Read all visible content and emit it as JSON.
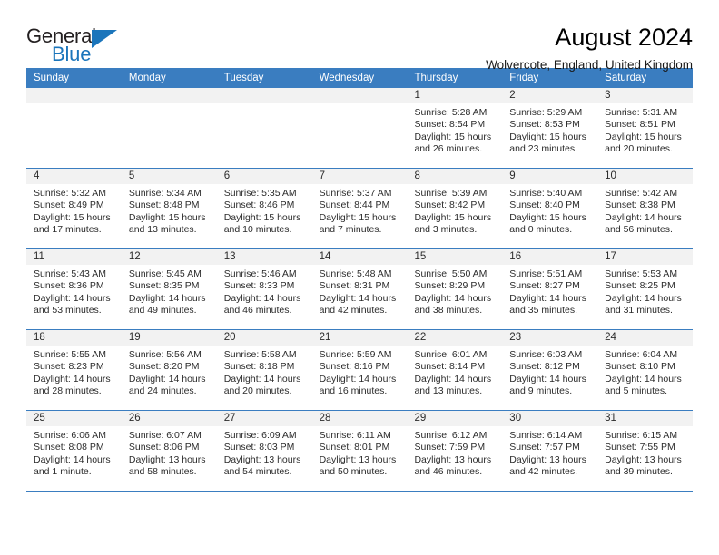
{
  "logo": {
    "word_top": "General",
    "word_bottom": "Blue",
    "accent_color": "#1b75bb"
  },
  "header": {
    "title": "August 2024",
    "location": "Wolvercote, England, United Kingdom",
    "header_bg_color": "#3a7dc0"
  },
  "calendar": {
    "day_headers": [
      "Sunday",
      "Monday",
      "Tuesday",
      "Wednesday",
      "Thursday",
      "Friday",
      "Saturday"
    ],
    "weeks": [
      [
        {
          "day": "",
          "empty": true
        },
        {
          "day": "",
          "empty": true
        },
        {
          "day": "",
          "empty": true
        },
        {
          "day": "",
          "empty": true
        },
        {
          "day": "1",
          "sunrise": "Sunrise: 5:28 AM",
          "sunset": "Sunset: 8:54 PM",
          "daylight1": "Daylight: 15 hours",
          "daylight2": "and 26 minutes."
        },
        {
          "day": "2",
          "sunrise": "Sunrise: 5:29 AM",
          "sunset": "Sunset: 8:53 PM",
          "daylight1": "Daylight: 15 hours",
          "daylight2": "and 23 minutes."
        },
        {
          "day": "3",
          "sunrise": "Sunrise: 5:31 AM",
          "sunset": "Sunset: 8:51 PM",
          "daylight1": "Daylight: 15 hours",
          "daylight2": "and 20 minutes."
        }
      ],
      [
        {
          "day": "4",
          "sunrise": "Sunrise: 5:32 AM",
          "sunset": "Sunset: 8:49 PM",
          "daylight1": "Daylight: 15 hours",
          "daylight2": "and 17 minutes."
        },
        {
          "day": "5",
          "sunrise": "Sunrise: 5:34 AM",
          "sunset": "Sunset: 8:48 PM",
          "daylight1": "Daylight: 15 hours",
          "daylight2": "and 13 minutes."
        },
        {
          "day": "6",
          "sunrise": "Sunrise: 5:35 AM",
          "sunset": "Sunset: 8:46 PM",
          "daylight1": "Daylight: 15 hours",
          "daylight2": "and 10 minutes."
        },
        {
          "day": "7",
          "sunrise": "Sunrise: 5:37 AM",
          "sunset": "Sunset: 8:44 PM",
          "daylight1": "Daylight: 15 hours",
          "daylight2": "and 7 minutes."
        },
        {
          "day": "8",
          "sunrise": "Sunrise: 5:39 AM",
          "sunset": "Sunset: 8:42 PM",
          "daylight1": "Daylight: 15 hours",
          "daylight2": "and 3 minutes."
        },
        {
          "day": "9",
          "sunrise": "Sunrise: 5:40 AM",
          "sunset": "Sunset: 8:40 PM",
          "daylight1": "Daylight: 15 hours",
          "daylight2": "and 0 minutes."
        },
        {
          "day": "10",
          "sunrise": "Sunrise: 5:42 AM",
          "sunset": "Sunset: 8:38 PM",
          "daylight1": "Daylight: 14 hours",
          "daylight2": "and 56 minutes."
        }
      ],
      [
        {
          "day": "11",
          "sunrise": "Sunrise: 5:43 AM",
          "sunset": "Sunset: 8:36 PM",
          "daylight1": "Daylight: 14 hours",
          "daylight2": "and 53 minutes."
        },
        {
          "day": "12",
          "sunrise": "Sunrise: 5:45 AM",
          "sunset": "Sunset: 8:35 PM",
          "daylight1": "Daylight: 14 hours",
          "daylight2": "and 49 minutes."
        },
        {
          "day": "13",
          "sunrise": "Sunrise: 5:46 AM",
          "sunset": "Sunset: 8:33 PM",
          "daylight1": "Daylight: 14 hours",
          "daylight2": "and 46 minutes."
        },
        {
          "day": "14",
          "sunrise": "Sunrise: 5:48 AM",
          "sunset": "Sunset: 8:31 PM",
          "daylight1": "Daylight: 14 hours",
          "daylight2": "and 42 minutes."
        },
        {
          "day": "15",
          "sunrise": "Sunrise: 5:50 AM",
          "sunset": "Sunset: 8:29 PM",
          "daylight1": "Daylight: 14 hours",
          "daylight2": "and 38 minutes."
        },
        {
          "day": "16",
          "sunrise": "Sunrise: 5:51 AM",
          "sunset": "Sunset: 8:27 PM",
          "daylight1": "Daylight: 14 hours",
          "daylight2": "and 35 minutes."
        },
        {
          "day": "17",
          "sunrise": "Sunrise: 5:53 AM",
          "sunset": "Sunset: 8:25 PM",
          "daylight1": "Daylight: 14 hours",
          "daylight2": "and 31 minutes."
        }
      ],
      [
        {
          "day": "18",
          "sunrise": "Sunrise: 5:55 AM",
          "sunset": "Sunset: 8:23 PM",
          "daylight1": "Daylight: 14 hours",
          "daylight2": "and 28 minutes."
        },
        {
          "day": "19",
          "sunrise": "Sunrise: 5:56 AM",
          "sunset": "Sunset: 8:20 PM",
          "daylight1": "Daylight: 14 hours",
          "daylight2": "and 24 minutes."
        },
        {
          "day": "20",
          "sunrise": "Sunrise: 5:58 AM",
          "sunset": "Sunset: 8:18 PM",
          "daylight1": "Daylight: 14 hours",
          "daylight2": "and 20 minutes."
        },
        {
          "day": "21",
          "sunrise": "Sunrise: 5:59 AM",
          "sunset": "Sunset: 8:16 PM",
          "daylight1": "Daylight: 14 hours",
          "daylight2": "and 16 minutes."
        },
        {
          "day": "22",
          "sunrise": "Sunrise: 6:01 AM",
          "sunset": "Sunset: 8:14 PM",
          "daylight1": "Daylight: 14 hours",
          "daylight2": "and 13 minutes."
        },
        {
          "day": "23",
          "sunrise": "Sunrise: 6:03 AM",
          "sunset": "Sunset: 8:12 PM",
          "daylight1": "Daylight: 14 hours",
          "daylight2": "and 9 minutes."
        },
        {
          "day": "24",
          "sunrise": "Sunrise: 6:04 AM",
          "sunset": "Sunset: 8:10 PM",
          "daylight1": "Daylight: 14 hours",
          "daylight2": "and 5 minutes."
        }
      ],
      [
        {
          "day": "25",
          "sunrise": "Sunrise: 6:06 AM",
          "sunset": "Sunset: 8:08 PM",
          "daylight1": "Daylight: 14 hours",
          "daylight2": "and 1 minute."
        },
        {
          "day": "26",
          "sunrise": "Sunrise: 6:07 AM",
          "sunset": "Sunset: 8:06 PM",
          "daylight1": "Daylight: 13 hours",
          "daylight2": "and 58 minutes."
        },
        {
          "day": "27",
          "sunrise": "Sunrise: 6:09 AM",
          "sunset": "Sunset: 8:03 PM",
          "daylight1": "Daylight: 13 hours",
          "daylight2": "and 54 minutes."
        },
        {
          "day": "28",
          "sunrise": "Sunrise: 6:11 AM",
          "sunset": "Sunset: 8:01 PM",
          "daylight1": "Daylight: 13 hours",
          "daylight2": "and 50 minutes."
        },
        {
          "day": "29",
          "sunrise": "Sunrise: 6:12 AM",
          "sunset": "Sunset: 7:59 PM",
          "daylight1": "Daylight: 13 hours",
          "daylight2": "and 46 minutes."
        },
        {
          "day": "30",
          "sunrise": "Sunrise: 6:14 AM",
          "sunset": "Sunset: 7:57 PM",
          "daylight1": "Daylight: 13 hours",
          "daylight2": "and 42 minutes."
        },
        {
          "day": "31",
          "sunrise": "Sunrise: 6:15 AM",
          "sunset": "Sunset: 7:55 PM",
          "daylight1": "Daylight: 13 hours",
          "daylight2": "and 39 minutes."
        }
      ]
    ]
  }
}
